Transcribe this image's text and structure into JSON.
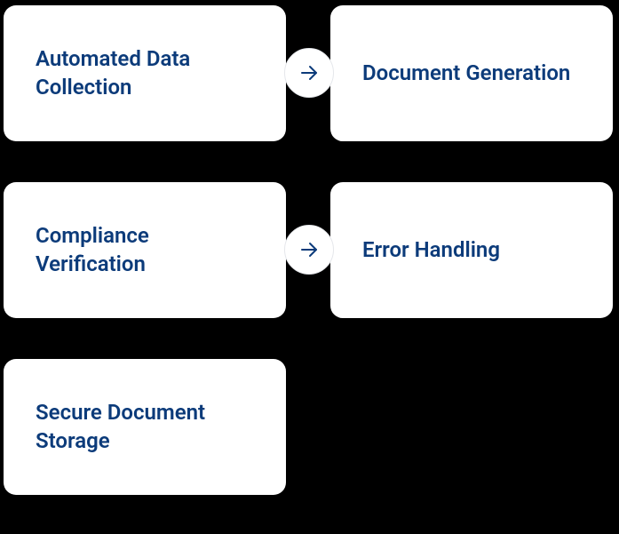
{
  "steps": [
    {
      "label": "Automated Data Collection"
    },
    {
      "label": "Document Generation"
    },
    {
      "label": "Compliance Verification"
    },
    {
      "label": "Error Handling"
    },
    {
      "label": "Secure Document Storage"
    }
  ]
}
